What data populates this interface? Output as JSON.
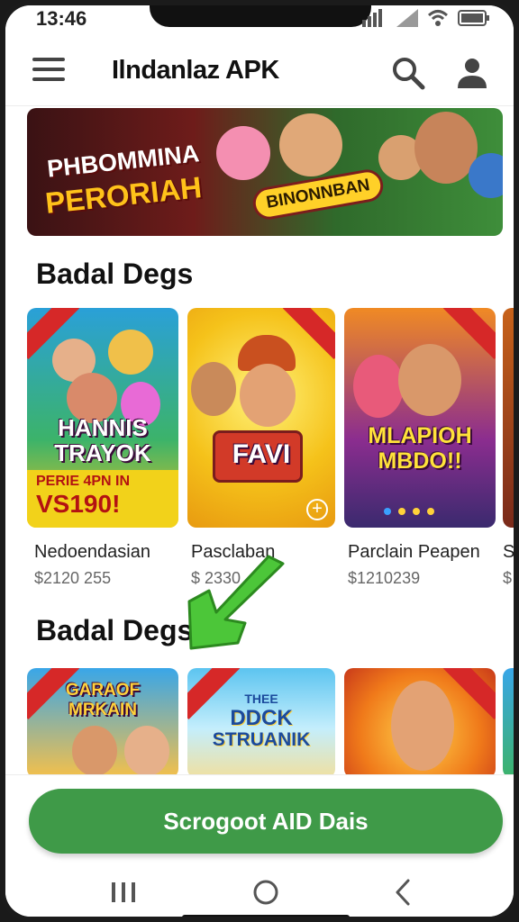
{
  "status_bar": {
    "time": "13:46"
  },
  "app_bar": {
    "title": "Ilndanlaz APK"
  },
  "banner": {
    "line1": "PHBOMMINA",
    "line2": "PERORIAH",
    "tag": "BINONNBAN"
  },
  "sections": [
    {
      "title": "Badal Degs",
      "cards": [
        {
          "art_line1": "HANNIS",
          "art_line2": "TRAYOK",
          "art_line3": "PERIE 4PN IN",
          "art_line4": "VS190!",
          "name": "Nedoendasian",
          "price": "$2120 255"
        },
        {
          "art_line1": "FAVI",
          "name": "Pasclaban",
          "price": "$ 2330"
        },
        {
          "art_line1": "MLAPIOH",
          "art_line2": "MBDO!!",
          "name": "Parclain Peapen",
          "price": "$1210239"
        }
      ],
      "partial_name": "S",
      "partial_price": "$"
    },
    {
      "title": "Badal Degs",
      "cards": [
        {
          "art_line1": "GARAOF",
          "art_line2": "MRKAIN"
        },
        {
          "art_line1": "THEE",
          "art_line2": "DDCK",
          "art_line3": "STRUANIK"
        },
        {
          "art_line1": ""
        }
      ]
    }
  ],
  "cta": {
    "label": "Scrogoot AID Dais"
  },
  "colors": {
    "cta_green": "#3f9a48",
    "arrow_green": "#4cc639"
  }
}
